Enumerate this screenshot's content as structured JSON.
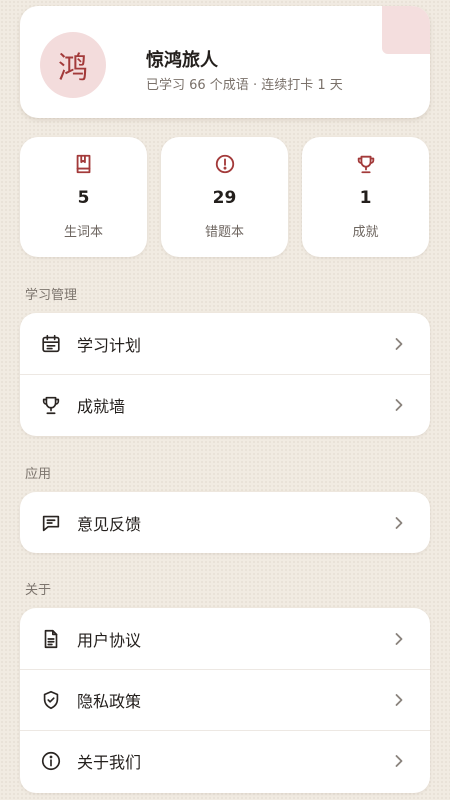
{
  "profile": {
    "avatar_char": "鸿",
    "nickname": "惊鸿旅人",
    "subtitle": "已学习 66 个成语 · 连续打卡 1 天"
  },
  "stats": [
    {
      "icon": "notebook-icon",
      "value": "5",
      "label": "生词本"
    },
    {
      "icon": "alert-circle-icon",
      "value": "29",
      "label": "错题本"
    },
    {
      "icon": "trophy-icon",
      "value": "1",
      "label": "成就"
    }
  ],
  "sections": [
    {
      "title": "学习管理",
      "items": [
        {
          "icon": "calendar-icon",
          "label": "学习计划"
        },
        {
          "icon": "trophy-icon",
          "label": "成就墙"
        }
      ]
    },
    {
      "title": "应用",
      "items": [
        {
          "icon": "message-icon",
          "label": "意见反馈"
        }
      ]
    },
    {
      "title": "关于",
      "items": [
        {
          "icon": "document-icon",
          "label": "用户协议"
        },
        {
          "icon": "shield-check-icon",
          "label": "隐私政策"
        },
        {
          "icon": "info-icon",
          "label": "关于我们"
        }
      ]
    }
  ],
  "colors": {
    "accent": "#a33a3a",
    "background": "#f1ebe2",
    "avatar_bg": "#f3dcdc"
  }
}
